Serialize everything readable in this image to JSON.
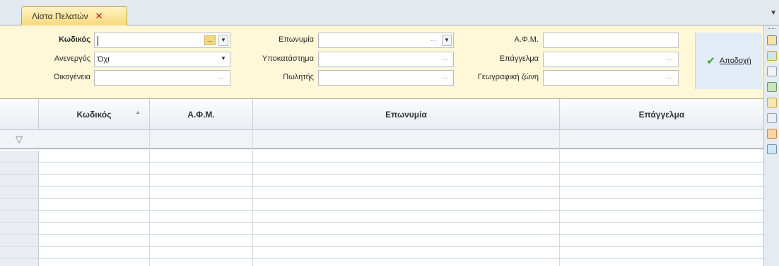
{
  "tab": {
    "title": "Λίστα Πελατών",
    "close": "✕"
  },
  "filters": {
    "kodikos_label": "Κωδικός",
    "kodikos_value": "",
    "anenergos_label": "Ανενεργός",
    "anenergos_value": "Όχι",
    "oikogeneia_label": "Οικογένεια",
    "eponymia_label": "Επωνυμία",
    "ypokatastima_label": "Υποκατάστημα",
    "politis_label": "Πωλητής",
    "afm_label": "Α.Φ.Μ.",
    "epaggelma_label": "Επάγγελμα",
    "geo_label": "Γεωγραφική ζώνη",
    "accept_label": "Αποδοχή"
  },
  "grid": {
    "columns": [
      "Κωδικός",
      "Α.Φ.Μ.",
      "Επωνυμία",
      "Επάγγελμα"
    ],
    "rows": []
  },
  "icons": {
    "tab_close": "close-icon",
    "accept": "check-icon",
    "filter_row": "filter-icon",
    "sort": "sort-asc-icon"
  },
  "colors": {
    "filter_panel_bg": "#fff8d8",
    "tab_active": "#f8d97a",
    "accept_green": "#3aa336",
    "close_red": "#b01818"
  }
}
